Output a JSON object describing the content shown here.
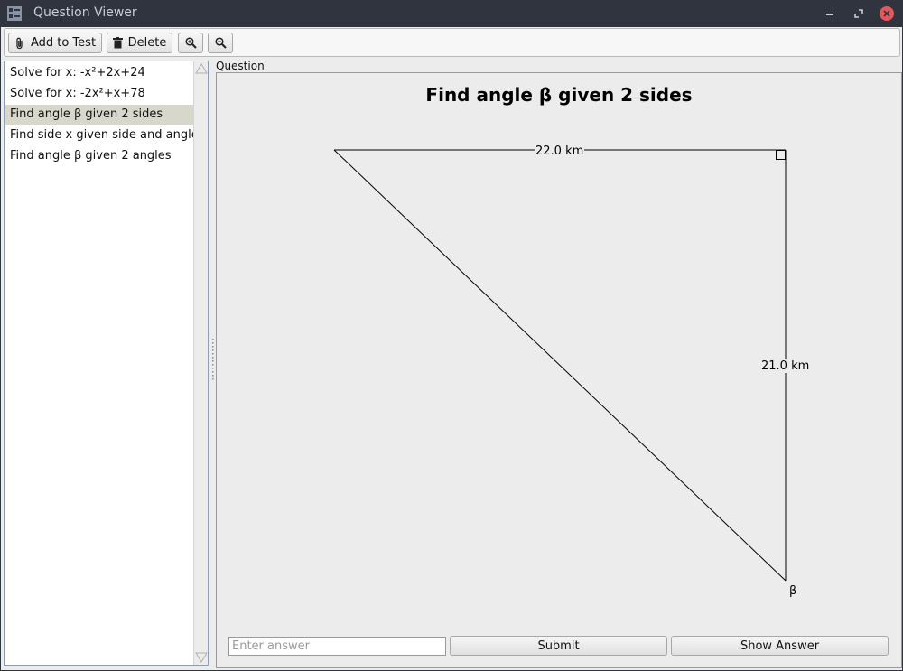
{
  "window": {
    "title": "Question Viewer",
    "accent_close": "#e55858"
  },
  "toolbar": {
    "add_label": "Add to Test",
    "delete_label": "Delete"
  },
  "questions": [
    {
      "label": "Solve for x: -x²+2x+24",
      "selected": false
    },
    {
      "label": "Solve for x: -2x²+x+78",
      "selected": false
    },
    {
      "label": "Find angle β given 2 sides",
      "selected": true
    },
    {
      "label": "Find side x given side and angle",
      "selected": false
    },
    {
      "label": "Find angle β given 2 angles",
      "selected": false
    }
  ],
  "question": {
    "section_label": "Question",
    "title": "Find angle β given 2 sides",
    "side_top": "22.0 km",
    "side_right": "21.0 km",
    "angle_symbol": "β"
  },
  "answer": {
    "placeholder": "Enter answer",
    "submit_label": "Submit",
    "show_label": "Show Answer"
  }
}
